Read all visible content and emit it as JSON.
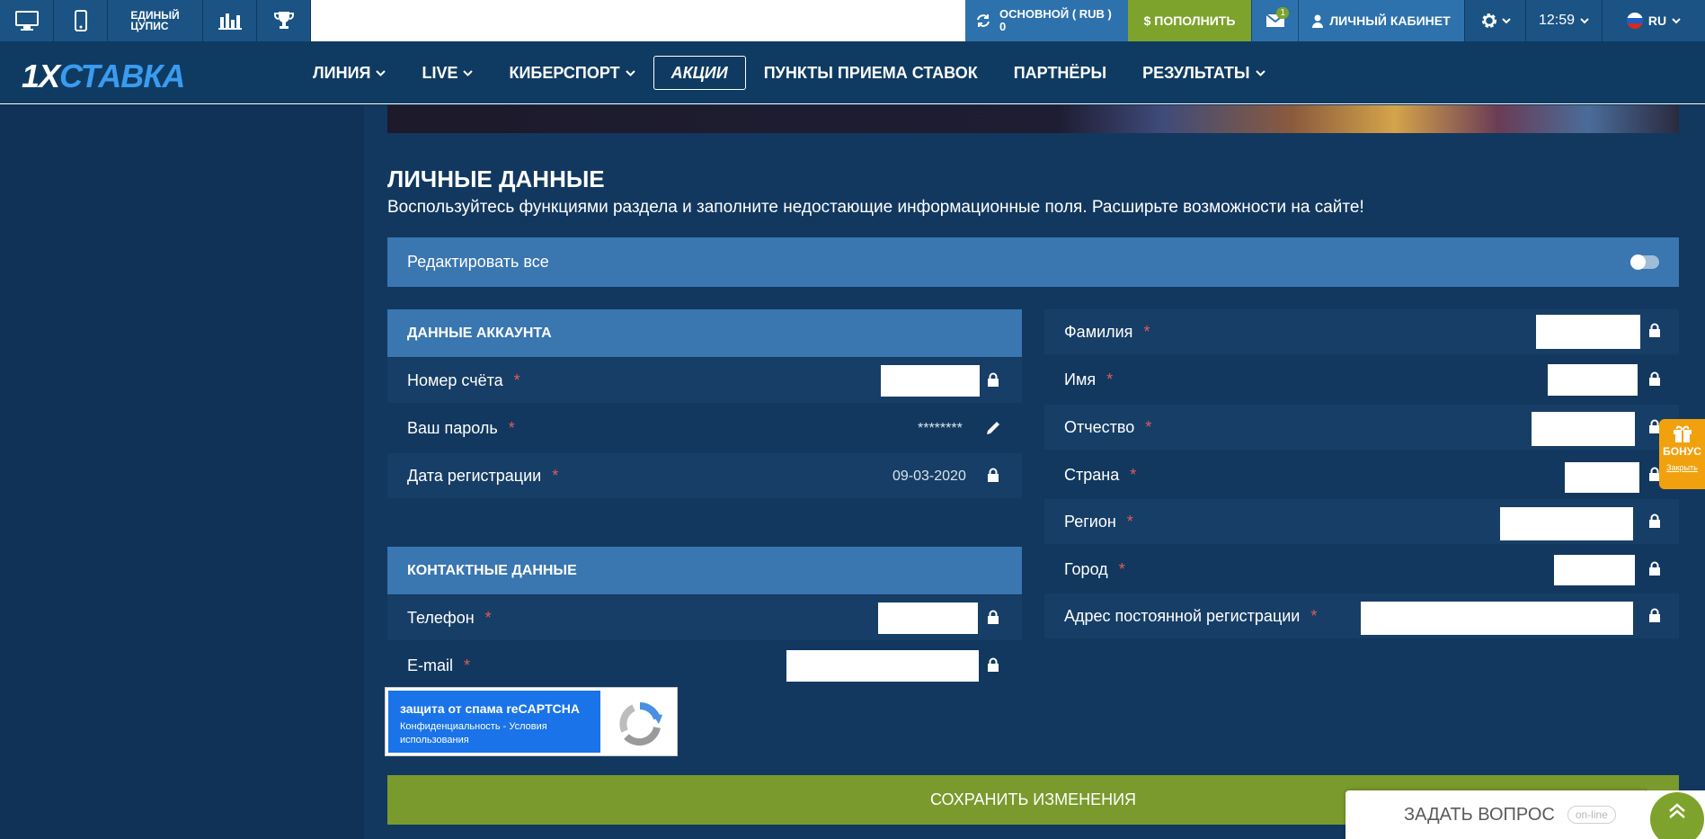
{
  "topbar": {
    "coupon_line1": "ЕДИНЫЙ",
    "coupon_line2": "ЦУПИС",
    "balance_label": "ОСНОВНОЙ ( RUB )",
    "balance_value": "0",
    "deposit": "$ ПОПОЛНИТЬ",
    "mail_badge": "1",
    "cabinet": "ЛИЧНЫЙ КАБИНЕТ",
    "time": "12:59",
    "lang": "RU"
  },
  "nav": {
    "logo_1x": "1X",
    "logo_text": "СТАВКА",
    "items": [
      "ЛИНИЯ",
      "LIVE",
      "КИБЕРСПОРТ",
      "АКЦИИ",
      "ПУНКТЫ ПРИЕМА СТАВОК",
      "ПАРТНЁРЫ",
      "РЕЗУЛЬТАТЫ"
    ]
  },
  "page": {
    "title": "ЛИЧНЫЕ ДАННЫЕ",
    "subtitle": "Воспользуйтесь функциями раздела и заполните недостающие информационные поля. Расширьте возможности на сайте!",
    "edit_all": "Редактировать все"
  },
  "account": {
    "header": "ДАННЫЕ АККАУНТА",
    "account_number": "Номер счёта",
    "password": "Ваш пароль",
    "password_value": "********",
    "reg_date": "Дата регистрации",
    "reg_date_value": "09-03-2020"
  },
  "contact": {
    "header": "КОНТАКТНЫЕ ДАННЫЕ",
    "phone": "Телефон",
    "email": "E-mail"
  },
  "personal": {
    "surname": "Фамилия",
    "name": "Имя",
    "patronymic": "Отчество",
    "country": "Страна",
    "region": "Регион",
    "city": "Город",
    "address": "Адрес постоянной регистрации"
  },
  "required_mark": "*",
  "captcha": {
    "title": "защита от спама reCAPTCHA",
    "links": "Конфиденциальность - Условия использования"
  },
  "save": "СОХРАНИТЬ ИЗМЕНЕНИЯ",
  "bonus": {
    "label": "БОНУС",
    "close": "Закрыть"
  },
  "ask": {
    "label": "ЗАДАТЬ ВОПРОС",
    "status": "on-line"
  },
  "colors": {
    "accent_green": "#7ea32c",
    "accent_blue": "#3a76b0",
    "bonus_orange": "#f2a10e"
  }
}
